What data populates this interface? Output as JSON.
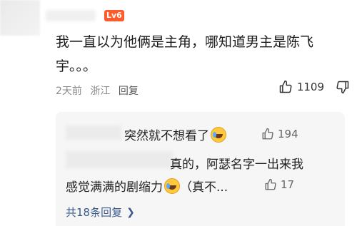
{
  "comment": {
    "level_badge": "Lv6",
    "text": "我一直以为他俩是主角，哪知道男主是陈飞宇。。。",
    "time": "2天前",
    "location": "浙江",
    "reply_label": "回复",
    "like_count": "1109"
  },
  "replies": [
    {
      "text": "突然就不想看了",
      "like_count": "194"
    },
    {
      "text_line1": "真的，阿瑟名字一出来我",
      "text_line2": "感觉满满的剧缩力",
      "text_tail": "（真不...",
      "like_count": "17"
    }
  ],
  "more_replies_label": "共18条回复",
  "colors": {
    "level_badge": "#ff5a2b",
    "link": "#3a5a8c",
    "meta": "#8a8a8a"
  }
}
